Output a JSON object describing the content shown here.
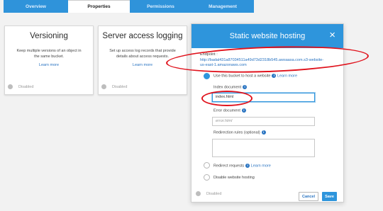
{
  "tabs": [
    {
      "label": "Overview",
      "active": false
    },
    {
      "label": "Properties",
      "active": true
    },
    {
      "label": "Permissions",
      "active": false
    },
    {
      "label": "Management",
      "active": false
    }
  ],
  "cards": {
    "versioning": {
      "title": "Versioning",
      "desc_line1": "Keep multiple versions of an object in",
      "desc_line2": "the same bucket.",
      "link": "Learn more",
      "status": "Disabled"
    },
    "logging": {
      "title": "Server access logging",
      "desc_line1": "Set up access log records that provide",
      "desc_line2": "details about access requests.",
      "link": "Learn more",
      "status": "Disabled"
    }
  },
  "panel": {
    "title": "Static website hosting",
    "close_icon": "×",
    "endpoint_label": "Endpoint :",
    "endpoint_line1": "http://badal431a87034511a49d73d2318b545.awsaasa.com.s3-website-",
    "endpoint_line2": "us-east-1.amazonaws.com",
    "option_host": "Use this bucket to host a website",
    "option_host_link": "Learn more",
    "index_label": "Index document",
    "index_value": "index.html",
    "error_label": "Error document",
    "error_placeholder": "error.html",
    "redirect_rules_label": "Redirection rules (optional)",
    "option_redirect": "Redirect requests",
    "option_redirect_link": "Learn more",
    "option_disable": "Disable website hosting",
    "status": "Disabled",
    "cancel_label": "Cancel",
    "save_label": "Save",
    "info_glyph": "i"
  },
  "colors": {
    "tab_blue": "#2f93da",
    "panel_header": "#2e95dc",
    "link": "#2873c1",
    "annotation_red": "#e0121c"
  }
}
